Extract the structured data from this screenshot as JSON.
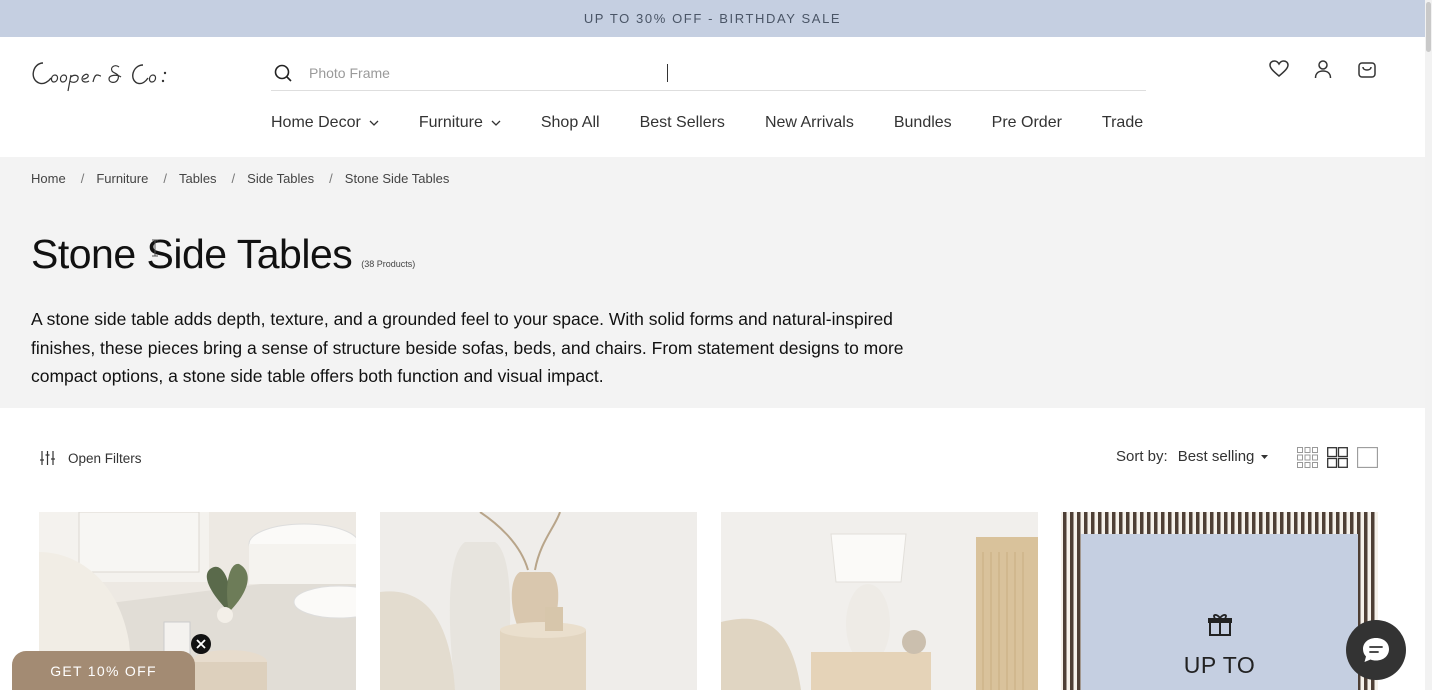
{
  "announcement": "UP TO 30% OFF - BIRTHDAY SALE",
  "brand": {
    "logo_text": "Cooper & Co."
  },
  "search": {
    "placeholder": "Photo Frame",
    "icon": "search-icon"
  },
  "header_icons": [
    "heart-icon",
    "account-icon",
    "cart-icon"
  ],
  "nav": [
    {
      "label": "Home Decor",
      "has_dropdown": true
    },
    {
      "label": "Furniture",
      "has_dropdown": true
    },
    {
      "label": "Shop All",
      "has_dropdown": false
    },
    {
      "label": "Best Sellers",
      "has_dropdown": false
    },
    {
      "label": "New Arrivals",
      "has_dropdown": false
    },
    {
      "label": "Bundles",
      "has_dropdown": false
    },
    {
      "label": "Pre Order",
      "has_dropdown": false
    },
    {
      "label": "Trade",
      "has_dropdown": false
    }
  ],
  "breadcrumb": [
    "Home",
    "Furniture",
    "Tables",
    "Side Tables",
    "Stone Side Tables"
  ],
  "breadcrumb_separator": "/",
  "page": {
    "title": "Stone Side Tables",
    "count": "(38 Products)",
    "description": "A stone side table adds depth, texture, and a grounded feel to your space. With solid forms and natural-inspired finishes, these pieces bring a sense of structure beside sofas, beds, and chairs. From statement designs to more compact options, a stone side table offers both function and visual impact."
  },
  "toolbar": {
    "filters_label": "Open Filters",
    "sort_label": "Sort by:",
    "sort_value": "Best selling",
    "view_options": [
      "grid-4-view",
      "grid-2-view",
      "single-view"
    ]
  },
  "promo_card": {
    "text": "UP TO",
    "icon": "gift-icon"
  },
  "discount_tab": {
    "label": "GET 10% OFF"
  },
  "colors": {
    "announcement_bg": "#c5cfe1",
    "hero_bg": "#f3f3f3",
    "discount_bg": "#a38b73",
    "promo_stripe": "#4e3f35",
    "promo_bg": "#c5cfe1"
  }
}
